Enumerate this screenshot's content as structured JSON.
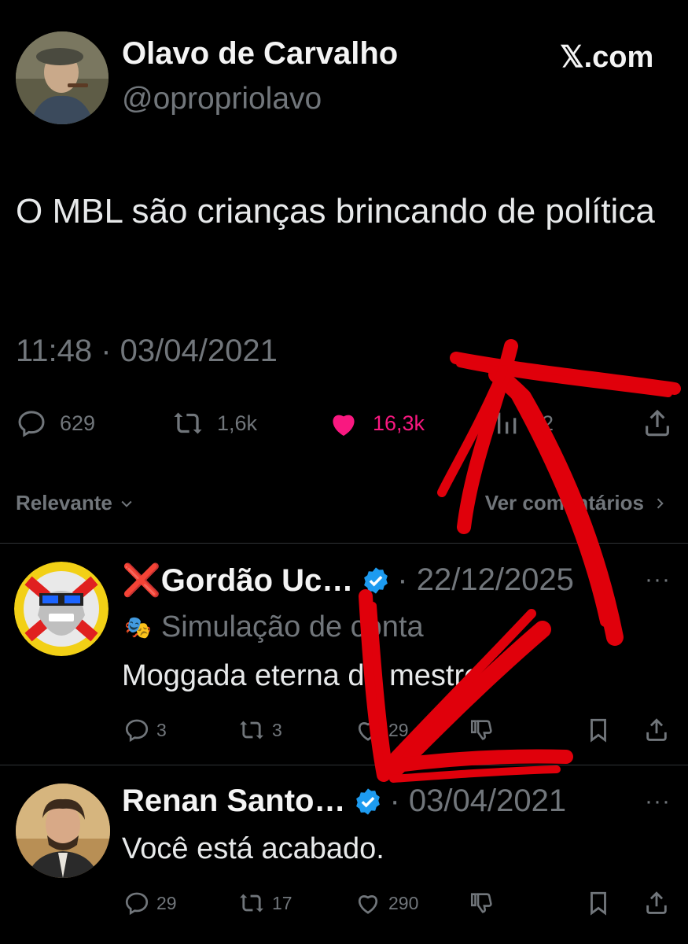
{
  "post": {
    "author_name": "Olavo de Carvalho",
    "author_handle": "@opropriolavo",
    "source": "𝕏.com",
    "text": "O MBL são crianças brincando de política",
    "timestamp": "11:48 · 03/04/2021",
    "stats": {
      "replies": "629",
      "reposts": "1,6k",
      "likes": "16,3k",
      "views": "32"
    }
  },
  "replies_bar": {
    "sort_label": "Relevante",
    "view_comments_label": "Ver comentários"
  },
  "replies": [
    {
      "name": "❌Gordão Uc…",
      "date": "· 22/12/2025",
      "sub_label": "Simulação de conta",
      "text": "Moggada eterna do mestre",
      "replies": "3",
      "reposts": "3",
      "likes": "29"
    },
    {
      "name": "Renan Santo…",
      "date": "· 03/04/2021",
      "text": "Você está acabado.",
      "replies": "29",
      "reposts": "17",
      "likes": "290"
    }
  ],
  "colors": {
    "background": "#000000",
    "muted": "#71767b",
    "like": "#f91880",
    "verified": "#1d9bf0",
    "annotation": "#e0000b"
  }
}
